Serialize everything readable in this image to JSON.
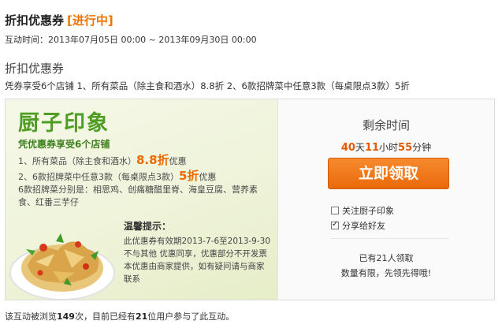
{
  "header": {
    "title": "折扣优惠券",
    "status": "[进行中]",
    "time_label": "互动时间：",
    "time_range": "2013年07月05日 00:00 ~ 2013年09月30日 00:00"
  },
  "coupon": {
    "section_title": "折扣优惠券",
    "description": "凭券享受6个店铺 1、所有菜品（除主食和酒水）8.8折 2、6款招牌菜中任意3款（每桌限点3款）5折"
  },
  "banner": {
    "brand": "厨子印象",
    "subhead": "凭优惠券享受6个店铺",
    "line1_prefix": "1、所有菜品（除主食和酒水）",
    "line1_highlight": "8.8折",
    "line1_suffix": "优惠",
    "line2_prefix": "2、6款招牌菜中任意3款（每桌限点3款）",
    "line2_highlight": "5折",
    "line2_suffix": "优惠",
    "line3": "6款招牌菜分别是：相思鸡、创痛糖醋里脊、海皇豆腐、营养素",
    "line4": "食、红番三芋仔",
    "tips_title": "温馨提示：",
    "tip1": "此优惠券有效期2013-7-6至2013-9-30",
    "tip2": "不与其他 优惠同享，优惠部分不开发票",
    "tip3": "本优惠由商家提供，如有疑问请与商家",
    "tip4": "联系"
  },
  "sidebar": {
    "remain_label": "剩余时间",
    "days": "40",
    "days_unit": "天",
    "hours": "11",
    "hours_unit": "小时",
    "minutes": "55",
    "minutes_unit": "分钟",
    "claim_button": "立即领取",
    "follow_label": "关注厨子印象",
    "follow_checked": false,
    "share_label": "分享给好友",
    "share_checked": true,
    "claimed_text": "已有21人领取",
    "hint_text": "数量有限，先领先得哦!"
  },
  "footer": {
    "prefix": "该互动被浏览",
    "views": "149",
    "middle": "次，目前已经有",
    "participants": "21",
    "suffix": "位用户参与了此互动。"
  },
  "colors": {
    "accent_orange": "#f07300",
    "brand_green": "#4f9d22",
    "button_orange": "#ee6e12"
  }
}
